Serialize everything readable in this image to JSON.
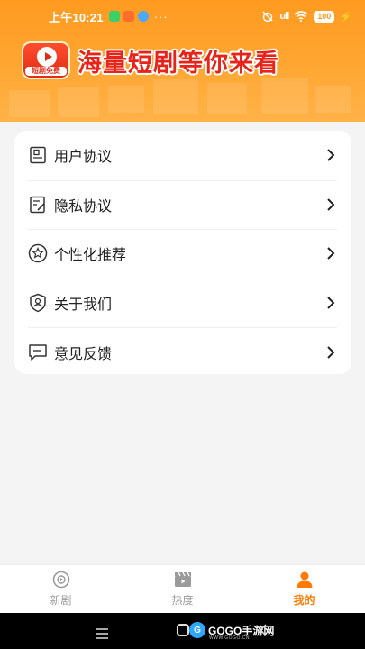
{
  "status_bar": {
    "time": "上午10:21",
    "dots": "···",
    "battery": "100",
    "signal": "ull",
    "badge_colors": [
      "#3ccf6a",
      "#ff6d2e",
      "#4aa8ff"
    ]
  },
  "banner": {
    "logo_text": "短剧免费",
    "slogan": "海量短剧等你来看",
    "background_color": "#ff9a1f",
    "slogan_color": "#e8241a"
  },
  "menu": {
    "items": [
      {
        "label": "用户协议",
        "icon": "user-agreement-icon"
      },
      {
        "label": "隐私协议",
        "icon": "privacy-icon"
      },
      {
        "label": "个性化推荐",
        "icon": "star-icon"
      },
      {
        "label": "关于我们",
        "icon": "shield-user-icon"
      },
      {
        "label": "意见反馈",
        "icon": "feedback-icon"
      }
    ]
  },
  "bottom_nav": {
    "items": [
      {
        "label": "新剧",
        "icon": "play-disc-icon",
        "active": false
      },
      {
        "label": "热度",
        "icon": "clapperboard-icon",
        "active": false
      },
      {
        "label": "我的",
        "icon": "person-icon",
        "active": true
      }
    ],
    "active_color": "#ff7a00"
  },
  "system_nav": {
    "watermark": "GOGO手游网",
    "watermark_sub": "WWW.GOGO.CN",
    "watermark_logo": "G"
  }
}
